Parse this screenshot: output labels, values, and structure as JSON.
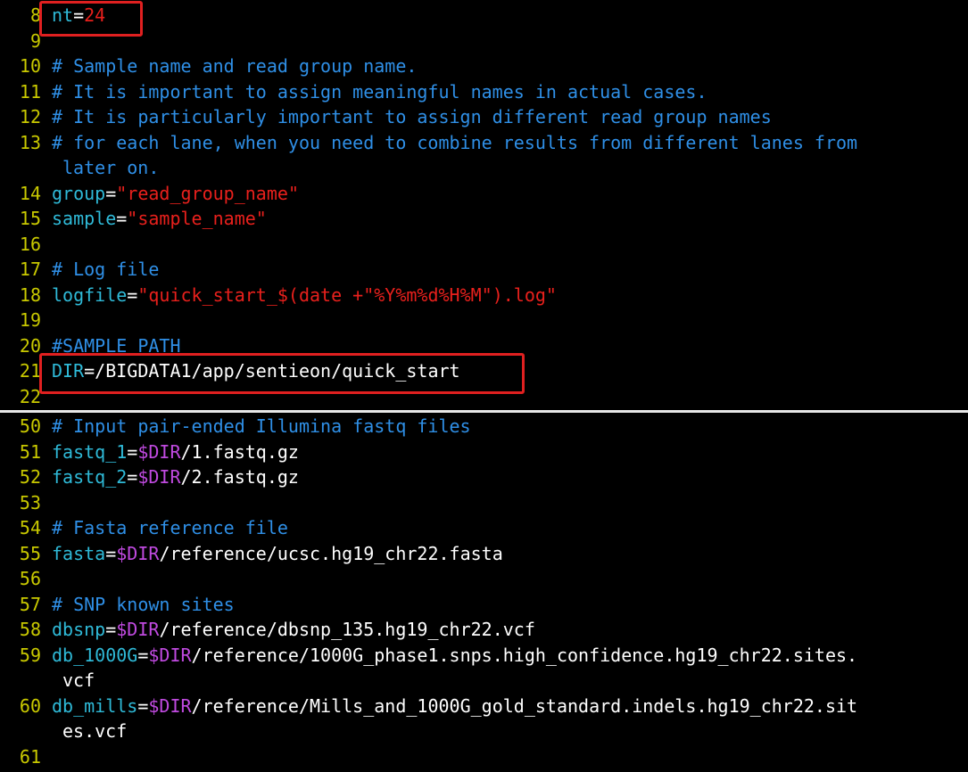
{
  "colors": {
    "line_number": "#c9c900",
    "variable": "#2fbad8",
    "string": "#e8201c",
    "plain": "#ffffff",
    "comment": "#2f8fe6",
    "shell_var": "#c04ae0",
    "highlight_box": "#e02020"
  },
  "top_pane": [
    {
      "n": "8",
      "segs": [
        {
          "t": "nt",
          "c": "variable"
        },
        {
          "t": "=",
          "c": "plain"
        },
        {
          "t": "24",
          "c": "string"
        }
      ]
    },
    {
      "n": "9",
      "segs": []
    },
    {
      "n": "10",
      "segs": [
        {
          "t": "# Sample name and read group name.",
          "c": "comment"
        }
      ]
    },
    {
      "n": "11",
      "segs": [
        {
          "t": "# It is important to assign meaningful names in actual cases.",
          "c": "comment"
        }
      ]
    },
    {
      "n": "12",
      "segs": [
        {
          "t": "# It is particularly important to assign different read group names",
          "c": "comment"
        }
      ]
    },
    {
      "n": "13",
      "segs": [
        {
          "t": "# for each lane, when you need to combine results from different lanes from",
          "c": "comment"
        }
      ],
      "cont": [
        {
          "t": "later on.",
          "c": "comment"
        }
      ]
    },
    {
      "n": "14",
      "segs": [
        {
          "t": "group",
          "c": "variable"
        },
        {
          "t": "=",
          "c": "plain"
        },
        {
          "t": "\"",
          "c": "string"
        },
        {
          "t": "read_group_name",
          "c": "string"
        },
        {
          "t": "\"",
          "c": "string"
        }
      ]
    },
    {
      "n": "15",
      "segs": [
        {
          "t": "sample",
          "c": "variable"
        },
        {
          "t": "=",
          "c": "plain"
        },
        {
          "t": "\"",
          "c": "string"
        },
        {
          "t": "sample_name",
          "c": "string"
        },
        {
          "t": "\"",
          "c": "string"
        }
      ]
    },
    {
      "n": "16",
      "segs": []
    },
    {
      "n": "17",
      "segs": [
        {
          "t": "# Log file",
          "c": "comment"
        }
      ]
    },
    {
      "n": "18",
      "segs": [
        {
          "t": "logfile",
          "c": "variable"
        },
        {
          "t": "=",
          "c": "plain"
        },
        {
          "t": "\"quick_start_$(date +\"%Y%m%d%H%M\").log\"",
          "c": "string"
        }
      ]
    },
    {
      "n": "19",
      "segs": []
    },
    {
      "n": "20",
      "segs": [
        {
          "t": "#SAMPLE PATH",
          "c": "comment"
        }
      ]
    },
    {
      "n": "21",
      "segs": [
        {
          "t": "DIR",
          "c": "variable"
        },
        {
          "t": "=/BIGDATA1/app/sentieon/quick_start",
          "c": "plain"
        }
      ]
    },
    {
      "n": "22",
      "segs": []
    }
  ],
  "bottom_pane": [
    {
      "n": "50",
      "segs": [
        {
          "t": "# Input pair-ended Illumina fastq files",
          "c": "comment"
        }
      ]
    },
    {
      "n": "51",
      "segs": [
        {
          "t": "fastq_1",
          "c": "variable"
        },
        {
          "t": "=",
          "c": "plain"
        },
        {
          "t": "$DIR",
          "c": "shell_var"
        },
        {
          "t": "/1.fastq.gz",
          "c": "plain"
        }
      ]
    },
    {
      "n": "52",
      "segs": [
        {
          "t": "fastq_2",
          "c": "variable"
        },
        {
          "t": "=",
          "c": "plain"
        },
        {
          "t": "$DIR",
          "c": "shell_var"
        },
        {
          "t": "/2.fastq.gz",
          "c": "plain"
        }
      ]
    },
    {
      "n": "53",
      "segs": []
    },
    {
      "n": "54",
      "segs": [
        {
          "t": "# Fasta reference file",
          "c": "comment"
        }
      ]
    },
    {
      "n": "55",
      "segs": [
        {
          "t": "fasta",
          "c": "variable"
        },
        {
          "t": "=",
          "c": "plain"
        },
        {
          "t": "$DIR",
          "c": "shell_var"
        },
        {
          "t": "/reference/ucsc.hg19_chr22.fasta",
          "c": "plain"
        }
      ]
    },
    {
      "n": "56",
      "segs": []
    },
    {
      "n": "57",
      "segs": [
        {
          "t": "# SNP known sites",
          "c": "comment"
        }
      ]
    },
    {
      "n": "58",
      "segs": [
        {
          "t": "dbsnp",
          "c": "variable"
        },
        {
          "t": "=",
          "c": "plain"
        },
        {
          "t": "$DIR",
          "c": "shell_var"
        },
        {
          "t": "/reference/dbsnp_135.hg19_chr22.vcf",
          "c": "plain"
        }
      ]
    },
    {
      "n": "59",
      "segs": [
        {
          "t": "db_1000G",
          "c": "variable"
        },
        {
          "t": "=",
          "c": "plain"
        },
        {
          "t": "$DIR",
          "c": "shell_var"
        },
        {
          "t": "/reference/1000G_phase1.snps.high_confidence.hg19_chr22.sites.",
          "c": "plain"
        }
      ],
      "cont": [
        {
          "t": "vcf",
          "c": "plain"
        }
      ]
    },
    {
      "n": "60",
      "segs": [
        {
          "t": "db_mills",
          "c": "variable"
        },
        {
          "t": "=",
          "c": "plain"
        },
        {
          "t": "$DIR",
          "c": "shell_var"
        },
        {
          "t": "/reference/Mills_and_1000G_gold_standard.indels.hg19_chr22.sit",
          "c": "plain"
        }
      ],
      "cont": [
        {
          "t": "es.vcf",
          "c": "plain"
        }
      ]
    },
    {
      "n": "61",
      "segs": []
    }
  ]
}
